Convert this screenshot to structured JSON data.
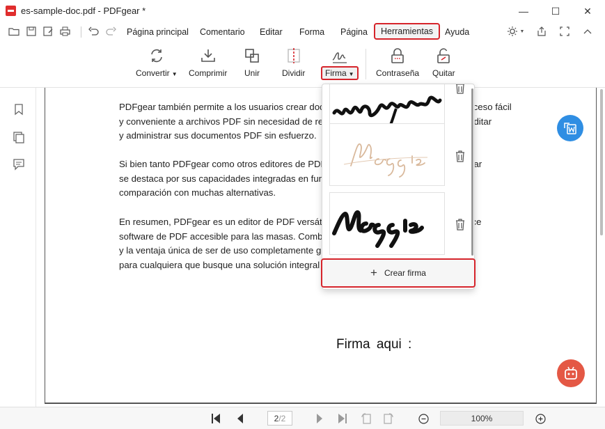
{
  "window": {
    "title": "es-sample-doc.pdf - PDFgear *",
    "minimize_glyph": "—",
    "maximize_glyph": "☐",
    "close_glyph": "✕"
  },
  "menu": {
    "items": [
      "Página principal",
      "Comentario",
      "Editar",
      "Forma",
      "Página",
      "Herramientas",
      "Ayuda"
    ],
    "active": "Herramientas"
  },
  "toolbar": {
    "tools": [
      {
        "label": "Convertir",
        "icon": "convert-icon",
        "has_dropdown": true
      },
      {
        "label": "Comprimir",
        "icon": "compress-icon"
      },
      {
        "label": "Unir",
        "icon": "merge-icon"
      },
      {
        "label": "Dividir",
        "icon": "split-icon"
      },
      {
        "label": "Firma",
        "icon": "signature-icon",
        "has_dropdown": true,
        "active": true
      },
      {
        "label": "Contraseña",
        "icon": "lock-icon"
      },
      {
        "label": "Quitar",
        "icon": "unlock-icon"
      }
    ]
  },
  "document": {
    "paragraphs": [
      [
        "PDFgear también permite a los usuarios crear documentos PDF, proporcionando un acceso fácil",
        "y conveniente a archivos PDF sin necesidad de registrarse. Los usuarios pueden ver, editar",
        "y administrar sus documentos PDF sin esfuerzo."
      ],
      [
        "Si bien tanto PDFgear como otros editores de PDF tienen sus propias ventajas, PDFgear",
        "se destaca por sus capacidades integradas en funciones avanzadas en",
        "comparación con muchas alternativas."
      ],
      [
        "En resumen, PDFgear es un editor de PDF versátil y una herramienta integral que ofrece",
        "software de PDF accesible para las masas. Combina la versatilidad y facilidad de uso",
        "y la ventaja única de ser de uso completamente gratis. Es una solución atractiva",
        "para cualquiera que busque una solución integral de PDF."
      ]
    ],
    "signature_label": "Firma aqui :"
  },
  "signature_panel": {
    "signatures": [
      {
        "text": "maggie",
        "style": "black-cursive-bold"
      },
      {
        "text": "Maggie",
        "style": "beige-script"
      },
      {
        "text": "Maggie",
        "style": "black-brush"
      }
    ],
    "create_label": "Crear firma"
  },
  "statusbar": {
    "current_page": "2",
    "total_pages": "/2",
    "zoom": "100%"
  },
  "colors": {
    "accent_red": "#d6242b",
    "fab_blue": "#2f8ee3",
    "fab_red": "#e45845"
  }
}
